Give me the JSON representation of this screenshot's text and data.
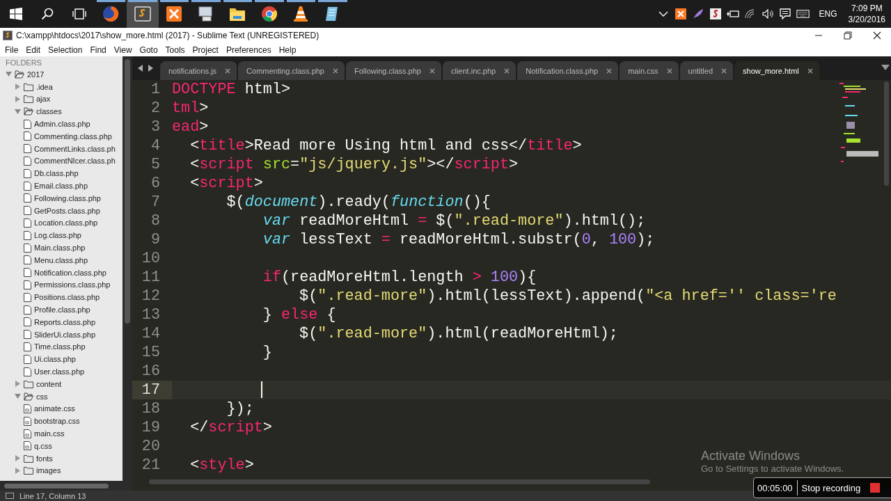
{
  "taskbar": {
    "buttons": [
      {
        "kind": "start",
        "selected": false
      },
      {
        "kind": "search",
        "selected": false
      },
      {
        "kind": "task-view",
        "selected": false
      },
      {
        "kind": "globe",
        "selected": false
      },
      {
        "kind": "editor",
        "selected": true
      },
      {
        "kind": "server",
        "selected": false
      },
      {
        "kind": "monitor",
        "selected": false
      },
      {
        "kind": "folder",
        "selected": false
      },
      {
        "kind": "ring",
        "selected": false
      },
      {
        "kind": "cone",
        "selected": false
      },
      {
        "kind": "notepad",
        "selected": false
      }
    ],
    "tray": {
      "icons": [
        {
          "kind": "chevron"
        },
        {
          "kind": "server"
        },
        {
          "kind": "feather"
        },
        {
          "kind": "tile"
        },
        {
          "kind": "plug"
        },
        {
          "kind": "wifi"
        },
        {
          "kind": "speaker"
        },
        {
          "kind": "notes"
        },
        {
          "kind": "keyboard"
        }
      ],
      "language": "ENG",
      "time": "7:09 PM",
      "date": "3/20/2016"
    }
  },
  "window": {
    "title": "C:\\xampp\\htdocs\\2017\\show_more.html (2017) - Sublime Text (UNREGISTERED)"
  },
  "menu": [
    "File",
    "Edit",
    "Selection",
    "Find",
    "View",
    "Goto",
    "Tools",
    "Project",
    "Preferences",
    "Help"
  ],
  "sidebar": {
    "header": "FOLDERS",
    "tree": [
      {
        "label": "2017",
        "kind": "folder",
        "expanded": true,
        "children": [
          {
            "label": ".idea",
            "kind": "folder",
            "expanded": false
          },
          {
            "label": "ajax",
            "kind": "folder",
            "expanded": false
          },
          {
            "label": "classes",
            "kind": "folder",
            "expanded": true,
            "children": [
              {
                "label": "Admin.class.php",
                "kind": "file"
              },
              {
                "label": "Commenting.class.php",
                "kind": "file"
              },
              {
                "label": "CommentLinks.class.ph",
                "kind": "file"
              },
              {
                "label": "CommentNIcer.class.ph",
                "kind": "file"
              },
              {
                "label": "Db.class.php",
                "kind": "file"
              },
              {
                "label": "Email.class.php",
                "kind": "file"
              },
              {
                "label": "Following.class.php",
                "kind": "file"
              },
              {
                "label": "GetPosts.class.php",
                "kind": "file"
              },
              {
                "label": "Location.class.php",
                "kind": "file"
              },
              {
                "label": "Log.class.php",
                "kind": "file"
              },
              {
                "label": "Main.class.php",
                "kind": "file"
              },
              {
                "label": "Menu.class.php",
                "kind": "file"
              },
              {
                "label": "Notification.class.php",
                "kind": "file"
              },
              {
                "label": "Permissions.class.php",
                "kind": "file"
              },
              {
                "label": "Positions.class.php",
                "kind": "file"
              },
              {
                "label": "Profile.class.php",
                "kind": "file"
              },
              {
                "label": "Reports.class.php",
                "kind": "file"
              },
              {
                "label": "SliderUi.class.php",
                "kind": "file"
              },
              {
                "label": "Time.class.php",
                "kind": "file"
              },
              {
                "label": "Ui.class.php",
                "kind": "file"
              },
              {
                "label": "User.class.php",
                "kind": "file"
              }
            ]
          },
          {
            "label": "content",
            "kind": "folder",
            "expanded": false
          },
          {
            "label": "css",
            "kind": "folder",
            "expanded": true,
            "children": [
              {
                "label": "animate.css",
                "kind": "stylesheet"
              },
              {
                "label": "bootstrap.css",
                "kind": "stylesheet"
              },
              {
                "label": "main.css",
                "kind": "stylesheet"
              },
              {
                "label": "q.css",
                "kind": "stylesheet"
              }
            ]
          },
          {
            "label": "fonts",
            "kind": "folder",
            "expanded": false
          },
          {
            "label": "images",
            "kind": "folder",
            "expanded": false
          }
        ]
      }
    ]
  },
  "tabs": [
    {
      "label": "notifications.js",
      "selected": false
    },
    {
      "label": "Commenting.class.php",
      "selected": false
    },
    {
      "label": "Following.class.php",
      "selected": false
    },
    {
      "label": "client.inc.php",
      "selected": false
    },
    {
      "label": "Notification.class.php",
      "selected": false
    },
    {
      "label": "main.css",
      "selected": false
    },
    {
      "label": "untitled",
      "selected": false
    },
    {
      "label": "show_more.html",
      "selected": true
    }
  ],
  "editor": {
    "lines": [
      {
        "number": "1",
        "current": false,
        "tokens": [
          {
            "kind": "tag",
            "text": "DOCTYPE"
          },
          {
            "kind": "plain",
            "text": " html>"
          }
        ]
      },
      {
        "number": "2",
        "current": false,
        "tokens": [
          {
            "kind": "tag",
            "text": "tml"
          },
          {
            "kind": "plain",
            "text": ">"
          }
        ]
      },
      {
        "number": "3",
        "current": false,
        "tokens": [
          {
            "kind": "tag",
            "text": "ead"
          },
          {
            "kind": "plain",
            "text": ">"
          }
        ]
      },
      {
        "number": "4",
        "current": false,
        "tokens": [
          {
            "kind": "plain",
            "text": "  <"
          },
          {
            "kind": "tag",
            "text": "title"
          },
          {
            "kind": "plain",
            "text": ">Read more Using html and css</"
          },
          {
            "kind": "tag",
            "text": "title"
          },
          {
            "kind": "plain",
            "text": ">"
          }
        ]
      },
      {
        "number": "5",
        "current": false,
        "tokens": [
          {
            "kind": "plain",
            "text": "  <"
          },
          {
            "kind": "tag",
            "text": "script"
          },
          {
            "kind": "attribute",
            "text": " src"
          },
          {
            "kind": "plain",
            "text": "="
          },
          {
            "kind": "string",
            "text": "\"js/jquery.js\""
          },
          {
            "kind": "plain",
            "text": "></"
          },
          {
            "kind": "tag",
            "text": "script"
          },
          {
            "kind": "plain",
            "text": ">"
          }
        ]
      },
      {
        "number": "6",
        "current": false,
        "tokens": [
          {
            "kind": "plain",
            "text": "  <"
          },
          {
            "kind": "tag",
            "text": "script"
          },
          {
            "kind": "plain",
            "text": ">"
          }
        ]
      },
      {
        "number": "7",
        "current": false,
        "tokens": [
          {
            "kind": "plain",
            "text": "      $("
          },
          {
            "kind": "keyword",
            "text": "document"
          },
          {
            "kind": "plain",
            "text": ").ready("
          },
          {
            "kind": "keyword",
            "text": "function"
          },
          {
            "kind": "plain",
            "text": "(){"
          }
        ]
      },
      {
        "number": "8",
        "current": false,
        "tokens": [
          {
            "kind": "keyword",
            "text": "          var"
          },
          {
            "kind": "plain",
            "text": " readMoreHtml "
          },
          {
            "kind": "operator",
            "text": "="
          },
          {
            "kind": "plain",
            "text": " $("
          },
          {
            "kind": "string",
            "text": "\".read-more\""
          },
          {
            "kind": "plain",
            "text": ").html();"
          }
        ]
      },
      {
        "number": "9",
        "current": false,
        "tokens": [
          {
            "kind": "keyword",
            "text": "          var"
          },
          {
            "kind": "plain",
            "text": " lessText "
          },
          {
            "kind": "operator",
            "text": "="
          },
          {
            "kind": "plain",
            "text": " readMoreHtml.substr("
          },
          {
            "kind": "number",
            "text": "0"
          },
          {
            "kind": "plain",
            "text": ", "
          },
          {
            "kind": "number",
            "text": "100"
          },
          {
            "kind": "plain",
            "text": ");"
          }
        ]
      },
      {
        "number": "10",
        "current": false
      },
      {
        "number": "11",
        "current": false,
        "tokens": [
          {
            "kind": "operator",
            "text": "          if"
          },
          {
            "kind": "plain",
            "text": "(readMoreHtml.length "
          },
          {
            "kind": "operator",
            "text": ">"
          },
          {
            "kind": "number",
            "text": " 100"
          },
          {
            "kind": "plain",
            "text": "){"
          }
        ]
      },
      {
        "number": "12",
        "current": false,
        "tokens": [
          {
            "kind": "plain",
            "text": "              $("
          },
          {
            "kind": "string",
            "text": "\".read-more\""
          },
          {
            "kind": "plain",
            "text": ").html(lessText).append("
          },
          {
            "kind": "string",
            "text": "\"<a href='' class='re"
          }
        ]
      },
      {
        "number": "13",
        "current": false,
        "tokens": [
          {
            "kind": "plain",
            "text": "          } "
          },
          {
            "kind": "operator",
            "text": "else"
          },
          {
            "kind": "plain",
            "text": " {"
          }
        ]
      },
      {
        "number": "14",
        "current": false,
        "tokens": [
          {
            "kind": "plain",
            "text": "              $("
          },
          {
            "kind": "string",
            "text": "\".read-more\""
          },
          {
            "kind": "plain",
            "text": ").html(readMoreHtml);"
          }
        ]
      },
      {
        "number": "15",
        "current": false,
        "tokens": [
          {
            "kind": "plain",
            "text": "          }"
          }
        ]
      },
      {
        "number": "16",
        "current": false
      },
      {
        "number": "17",
        "current": true
      },
      {
        "number": "18",
        "current": false,
        "tokens": [
          {
            "kind": "plain",
            "text": "      });"
          }
        ]
      },
      {
        "number": "19",
        "current": false,
        "tokens": [
          {
            "kind": "plain",
            "text": "  </"
          },
          {
            "kind": "tag",
            "text": "script"
          },
          {
            "kind": "plain",
            "text": ">"
          }
        ]
      },
      {
        "number": "20",
        "current": false
      },
      {
        "number": "21",
        "current": false,
        "tokens": [
          {
            "kind": "plain",
            "text": "  <"
          },
          {
            "kind": "tag",
            "text": "style"
          },
          {
            "kind": "plain",
            "text": ">"
          }
        ]
      }
    ]
  },
  "status_bar": {
    "position": "Line 17, Column 13"
  },
  "activation_notice": {
    "title": "Activate Windows",
    "subtitle": "Go to Settings to activate Windows."
  },
  "recorder": {
    "elapsed": "00:05:00",
    "action": "Stop recording"
  }
}
